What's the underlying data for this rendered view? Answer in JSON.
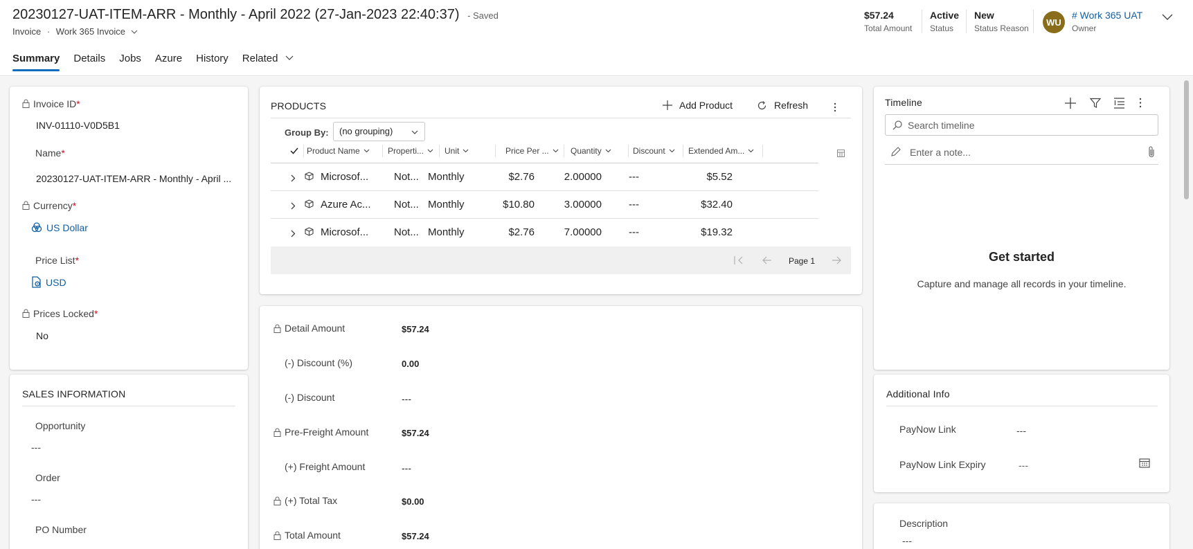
{
  "header": {
    "title": "20230127-UAT-ITEM-ARR - Monthly - April 2022 (27-Jan-2023 22:40:37)",
    "saved_status": "- Saved",
    "entity": "Invoice",
    "separator": "·",
    "form": "Work 365 Invoice",
    "kpis": [
      {
        "value": "$57.24",
        "label": "Total Amount"
      },
      {
        "value": "Active",
        "label": "Status"
      },
      {
        "value": "New",
        "label": "Status Reason"
      }
    ],
    "owner": {
      "initials": "WU",
      "name": "# Work 365 UAT",
      "label": "Owner"
    }
  },
  "tabs": [
    "Summary",
    "Details",
    "Jobs",
    "Azure",
    "History",
    "Related"
  ],
  "general": {
    "invoice_id_label": "Invoice ID",
    "invoice_id": "INV-01110-V0D5B1",
    "name_label": "Name",
    "name": "20230127-UAT-ITEM-ARR - Monthly - April ...",
    "currency_label": "Currency",
    "currency": "US Dollar",
    "price_list_label": "Price List",
    "price_list": "USD",
    "prices_locked_label": "Prices Locked",
    "prices_locked": "No",
    "required_mark": "*"
  },
  "sales": {
    "title": "SALES INFORMATION",
    "opportunity_label": "Opportunity",
    "opportunity": "---",
    "order_label": "Order",
    "order": "---",
    "po_label": "PO Number"
  },
  "products": {
    "title": "PRODUCTS",
    "add_label": "Add Product",
    "refresh_label": "Refresh",
    "group_by_label": "Group By:",
    "group_by_value": "(no grouping)",
    "columns": [
      "Product Name",
      "Properti...",
      "Unit",
      "Price Per ...",
      "Quantity",
      "Discount",
      "Extended Am..."
    ],
    "rows": [
      {
        "name": "Microsof...",
        "properties": "Not...",
        "unit": "Monthly",
        "price": "$2.76",
        "quantity": "2.00000",
        "discount": "---",
        "extended": "$5.52"
      },
      {
        "name": "Azure Ac...",
        "properties": "Not...",
        "unit": "Monthly",
        "price": "$10.80",
        "quantity": "3.00000",
        "discount": "---",
        "extended": "$32.40"
      },
      {
        "name": "Microsof...",
        "properties": "Not...",
        "unit": "Monthly",
        "price": "$2.76",
        "quantity": "7.00000",
        "discount": "---",
        "extended": "$19.32"
      }
    ],
    "page_label": "Page 1"
  },
  "totals": [
    {
      "label": "Detail Amount",
      "value": "$57.24",
      "locked": true
    },
    {
      "label": "(-) Discount (%)",
      "value": "0.00",
      "locked": false
    },
    {
      "label": "(-) Discount",
      "value": "---",
      "locked": false
    },
    {
      "label": "Pre-Freight Amount",
      "value": "$57.24",
      "locked": true
    },
    {
      "label": "(+) Freight Amount",
      "value": "---",
      "locked": false
    },
    {
      "label": "(+) Total Tax",
      "value": "$0.00",
      "locked": true
    },
    {
      "label": "Total Amount",
      "value": "$57.24",
      "locked": true
    }
  ],
  "timeline": {
    "title": "Timeline",
    "search_placeholder": "Search timeline",
    "note_placeholder": "Enter a note...",
    "empty_title": "Get started",
    "empty_text": "Capture and manage all records in your timeline."
  },
  "additional": {
    "title": "Additional Info",
    "paynow_link_label": "PayNow Link",
    "paynow_link": "---",
    "paynow_expiry_label": "PayNow Link Expiry",
    "paynow_expiry": "---"
  },
  "description": {
    "label": "Description",
    "value": "---"
  },
  "colors": {
    "accent": "#0f6cbd",
    "link": "#115ea3",
    "required": "#c50f1f",
    "avatar": "#8a6d1a"
  }
}
